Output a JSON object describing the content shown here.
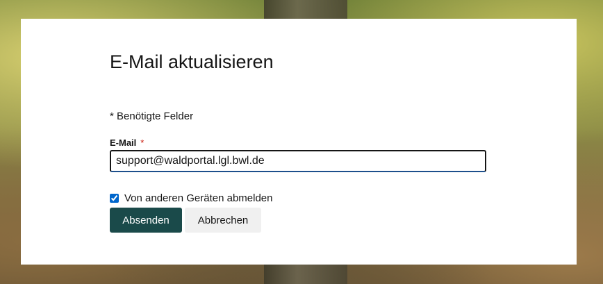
{
  "form": {
    "title": "E-Mail aktualisieren",
    "required_note": "* Benötigte Felder",
    "email_label": "E-Mail",
    "required_marker": "*",
    "email_value": "support@waldportal.lgl.bwl.de",
    "logout_label": "Von anderen Geräten abmelden",
    "logout_checked": true,
    "submit_label": "Absenden",
    "cancel_label": "Abbrechen"
  },
  "colors": {
    "submit_bg": "#1a4a4a",
    "cancel_bg": "#f0f0f0",
    "required_marker": "#c9190b",
    "input_focus_border": "#1d4f8c"
  }
}
